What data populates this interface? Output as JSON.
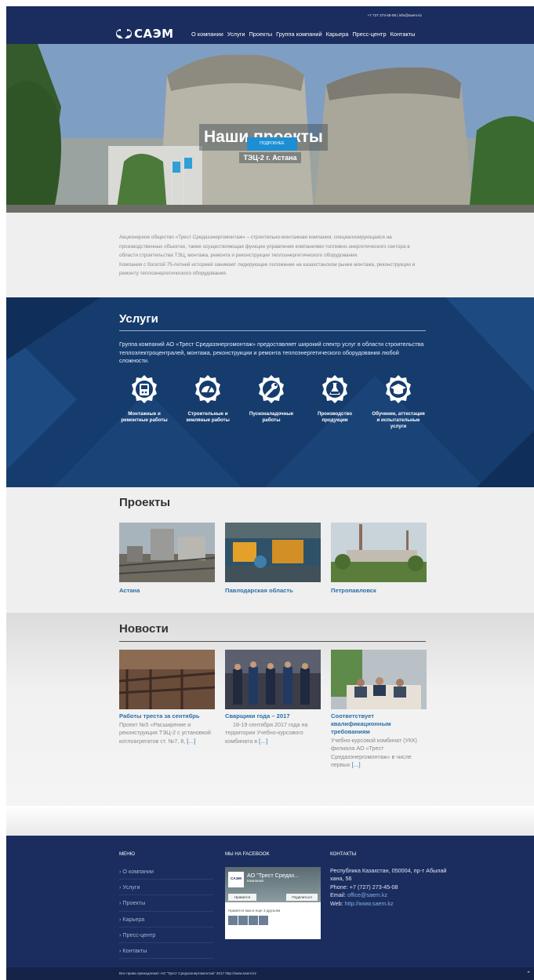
{
  "header": {
    "phone": "+7 727 273-45-08",
    "separator": "|",
    "email": "info@saem.kz",
    "logo_text": "САЭМ",
    "nav": [
      "О компании",
      "Услуги",
      "Проекты",
      "Группа компаний",
      "Карьера",
      "Пресс-центр",
      "Контакты"
    ]
  },
  "hero": {
    "title": "Наши проекты",
    "subtitle": "ТЭЦ-2 г. Астана",
    "button": "ПОДРОБНЕЕ"
  },
  "about": {
    "text": "Акционерное общество «Трест Средазэнергомонтаж» – строительно-монтажная компания, специализирующаяся на производственных объектах, также осуществляющая функции управления компаниями топливно-энергетического сектора в области строительства ТЭЦ, монтажа, ремонта и реконструкции теплоэнергетического оборудования.",
    "text2": "Компания с богатой 75-летней историей занимает лидирующее положение на казахстанском рынке монтажа, реконструкции и ремонту теплоэнергетического оборудования."
  },
  "services": {
    "title": "Услуги",
    "intro": "Группа компаний АО «Трест Средазэнергомонтаж» предоставляет широкий спектр услуг в области строительства теплоэлектроцентралей, монтажа, реконструкции и ремонта теплоэнергетического оборудования любой сложности.",
    "items": [
      {
        "label": "Монтажные и ремонтные работы",
        "icon": "gauge-panel-icon"
      },
      {
        "label": "Строительные и земляные работы",
        "icon": "speedometer-icon"
      },
      {
        "label": "Пусконаладочные работы",
        "icon": "wrench-icon"
      },
      {
        "label": "Производство продукции",
        "icon": "flask-icon"
      },
      {
        "label": "Обучение, аттестация и испытательные услуги",
        "icon": "graduation-cap-icon"
      }
    ]
  },
  "projects": {
    "title": "Проекты",
    "items": [
      "Астана",
      "Павлодарская область",
      "Петропавловск"
    ]
  },
  "news": {
    "title": "Новости",
    "items": [
      {
        "title": "Работы треста за сентябрь",
        "text": "Проект №5 «Расширение и реконструкция ТЭЦ-2 с установкой котлоагрегатов ст. №7, 8,",
        "more": "[…]"
      },
      {
        "title": "Сварщики года – 2017",
        "text": "18-19 сентября 2017 года на территории Учебно-курсового комбината в",
        "more": "[…]"
      },
      {
        "title": "Соответствует квалификационным требованиям",
        "text": "Учебно-курсовой комбинат (УКК) филиала АО «Трест Средазэнергомонтаж» в числе первых",
        "more": "[…]"
      }
    ]
  },
  "footer": {
    "menu_title": "Меню",
    "menu": [
      "› О компании",
      "› Услуги",
      "› Проекты",
      "› Карьера",
      "› Пресс-центр",
      "› Контакты"
    ],
    "facebook_title": "Мы на Facebook",
    "fb_logo": "САЭМ",
    "fb_page_name": "АО \"Трест Средаз...",
    "fb_page_sub": "Компания",
    "fb_like": "Нравится",
    "fb_share": "Поделиться",
    "fb_friends": "Нравится вам и еще 3 друзьям",
    "contacts_title": "Контакты",
    "address": "Республика Казахстан, 050004, пр-т Абылай хана, 56",
    "phone": "Phone: +7 (727) 273-45-08",
    "email_label": "Email:",
    "email": "office@saem.kz",
    "web_label": "Web:",
    "web": "http://www.saem.kz",
    "copyright": "Все права принадлежат АО \"Трест Средазэнергомонтаж\" 2017 http://www.saem.kz",
    "to_top": "⌃"
  },
  "colors": {
    "navy": "#1b2d5e",
    "blue_band": "#143a6b",
    "accent": "#1c8fd4",
    "link": "#2a6fa8"
  }
}
